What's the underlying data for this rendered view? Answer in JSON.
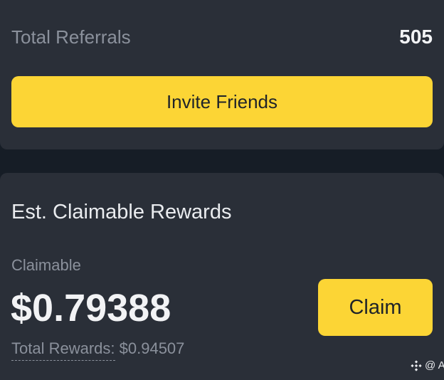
{
  "referrals": {
    "label": "Total Referrals",
    "value": "505"
  },
  "invite_button": {
    "label": "Invite Friends"
  },
  "rewards": {
    "title": "Est. Claimable Rewards",
    "claimable_label": "Claimable",
    "claimable_amount": "$0.79388",
    "claim_button_label": "Claim",
    "total_label": "Total Rewards:",
    "total_value": "$0.94507"
  },
  "watermark": {
    "text": "@ A",
    "icon": "binance-logo-icon"
  },
  "colors": {
    "background": "#161d26",
    "card": "#2a2f38",
    "accent": "#fcd535",
    "primary_text": "#f2f3f5",
    "secondary_text": "#8b919c",
    "button_text": "#1e2329"
  }
}
